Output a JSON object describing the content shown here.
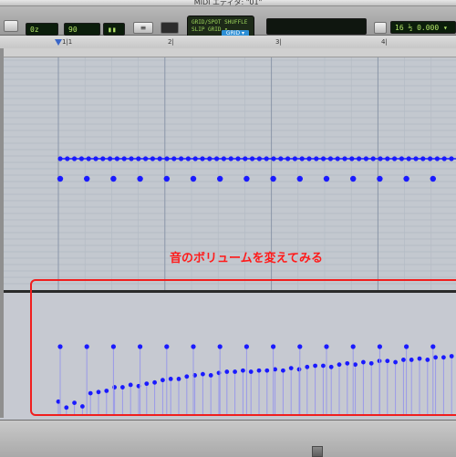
{
  "window": {
    "title": "MIDI エディタ: \"01\""
  },
  "toolbar": {
    "grid_value": "0z",
    "nudge_value": "90",
    "counter_value": "▮▮",
    "mode_lines": [
      "GRID/SPOT   SHUFFLE",
      "SLIP        GRID ▾"
    ],
    "mode_selected": "GRID ▾",
    "cursor_lcd": "",
    "tempo_lcd": "16 ½ 0.000  ▾",
    "button_small": "≡"
  },
  "ruler": {
    "bars": [
      "1|1",
      "2|",
      "3|",
      "4|"
    ]
  },
  "annotation": "音のボリュームを変えてみる",
  "colors": {
    "note": "#1a1aff",
    "velocity_stem": "#9a9ae8",
    "annotation": "#ff1a1a",
    "grid_bg": "#c4c9cf",
    "lane_bg": "#c9ccd4"
  },
  "notes": {
    "upper_row_count": 56,
    "lower_row_count": 15
  },
  "velocity": {
    "levels_tall": [
      0.58,
      0.58,
      0.58,
      0.58,
      0.58,
      0.58,
      0.58,
      0.58,
      0.58,
      0.58,
      0.58,
      0.58,
      0.58,
      0.58,
      0.58
    ],
    "levels_short": [
      0.12,
      0.07,
      0.11,
      0.08,
      0.19,
      0.2,
      0.21,
      0.24,
      0.24,
      0.26,
      0.25,
      0.27,
      0.28,
      0.3,
      0.31,
      0.31,
      0.33,
      0.34,
      0.35,
      0.34,
      0.36,
      0.37,
      0.37,
      0.38,
      0.37,
      0.38,
      0.38,
      0.39,
      0.38,
      0.4,
      0.39,
      0.41,
      0.42,
      0.42,
      0.41,
      0.43,
      0.44,
      0.43,
      0.45,
      0.44,
      0.46,
      0.46,
      0.45,
      0.47,
      0.47,
      0.48,
      0.47,
      0.49,
      0.49,
      0.5
    ]
  }
}
